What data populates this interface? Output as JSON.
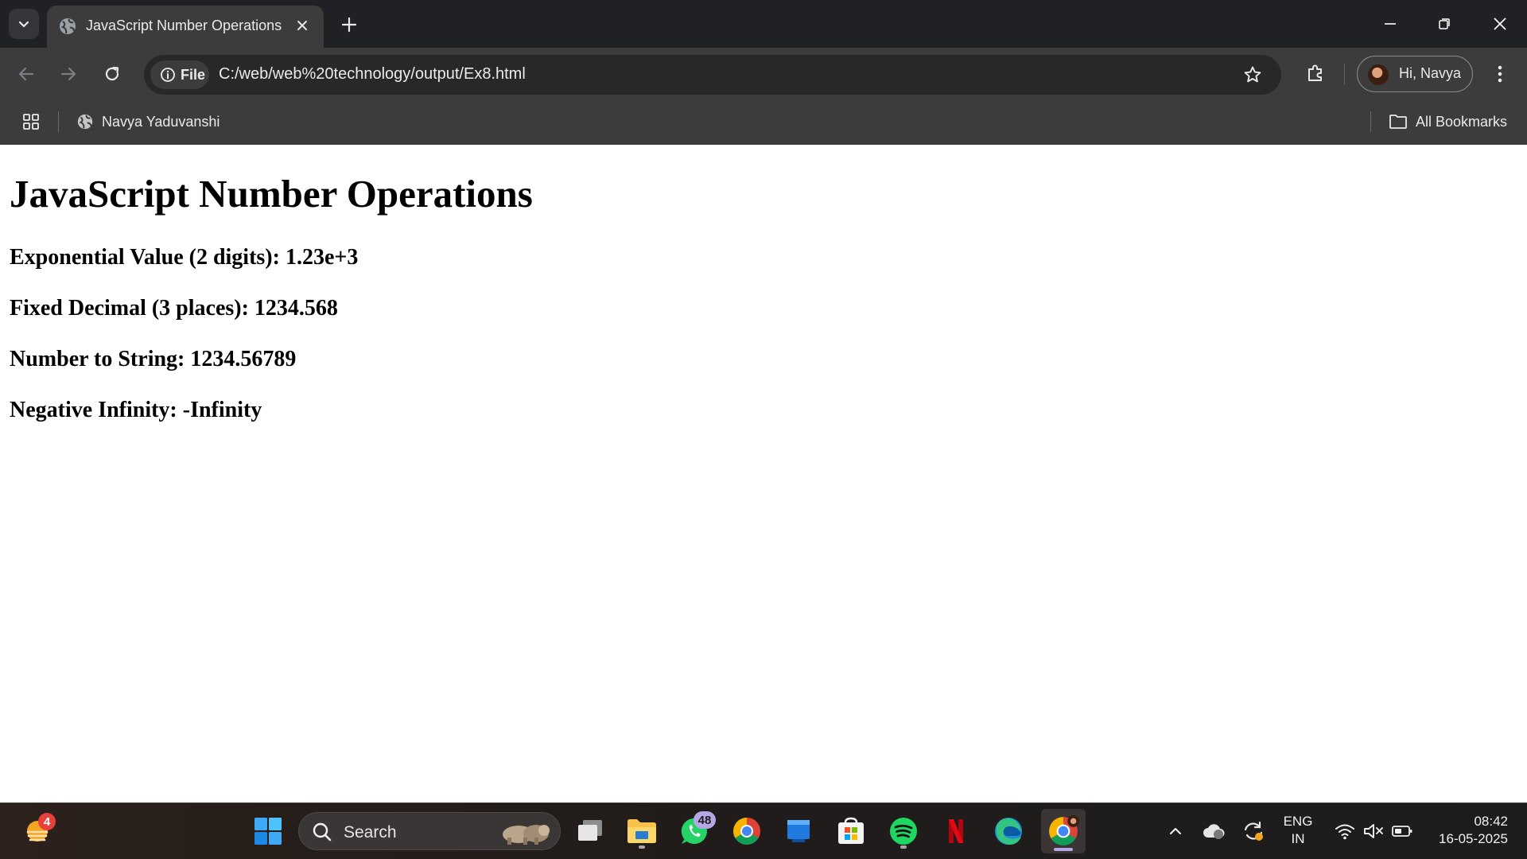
{
  "browser": {
    "tab": {
      "title": "JavaScript Number Operations"
    },
    "omnibox": {
      "chip_label": "File",
      "url": "C:/web/web%20technology/output/Ex8.html"
    },
    "profile": {
      "label": "Hi, Navya"
    },
    "bookmarks": {
      "items": [
        {
          "label": "Navya Yaduvanshi"
        }
      ],
      "all_label": "All Bookmarks"
    }
  },
  "page": {
    "heading": "JavaScript Number Operations",
    "lines": [
      "Exponential Value (2 digits): 1.23e+3",
      "Fixed Decimal (3 places): 1234.568",
      "Number to String: 1234.56789",
      "Negative Infinity: -Infinity"
    ]
  },
  "taskbar": {
    "weather_badge": "4",
    "search_label": "Search",
    "whatsapp_badge": "48",
    "language": {
      "line1": "ENG",
      "line2": "IN"
    },
    "clock": {
      "time": "08:42",
      "date": "16-05-2025"
    }
  },
  "colors": {
    "titlebar": "#202124",
    "toolbar": "#3c3c3c",
    "omnibox": "#282828",
    "page_background": "#ffffff",
    "text": "#000000",
    "badge_purple": "#b6a7e6",
    "badge_red": "#e8403a"
  },
  "icons": [
    "chevron-down-icon",
    "globe-icon",
    "close-icon",
    "plus-icon",
    "minimize-icon",
    "restore-icon",
    "back-arrow-icon",
    "forward-arrow-icon",
    "reload-icon",
    "info-icon",
    "star-icon",
    "puzzle-icon",
    "kebab-menu-icon",
    "apps-grid-icon",
    "folder-icon",
    "weather-icon",
    "windows-start-icon",
    "search-icon",
    "task-view-icon",
    "file-explorer-icon",
    "whatsapp-icon",
    "chrome-icon",
    "blue-app-icon",
    "microsoft-store-icon",
    "spotify-icon",
    "netflix-icon",
    "edge-icon",
    "chevron-up-icon",
    "cloud-icon",
    "sync-icon",
    "wifi-icon",
    "speaker-muted-icon",
    "battery-icon"
  ]
}
